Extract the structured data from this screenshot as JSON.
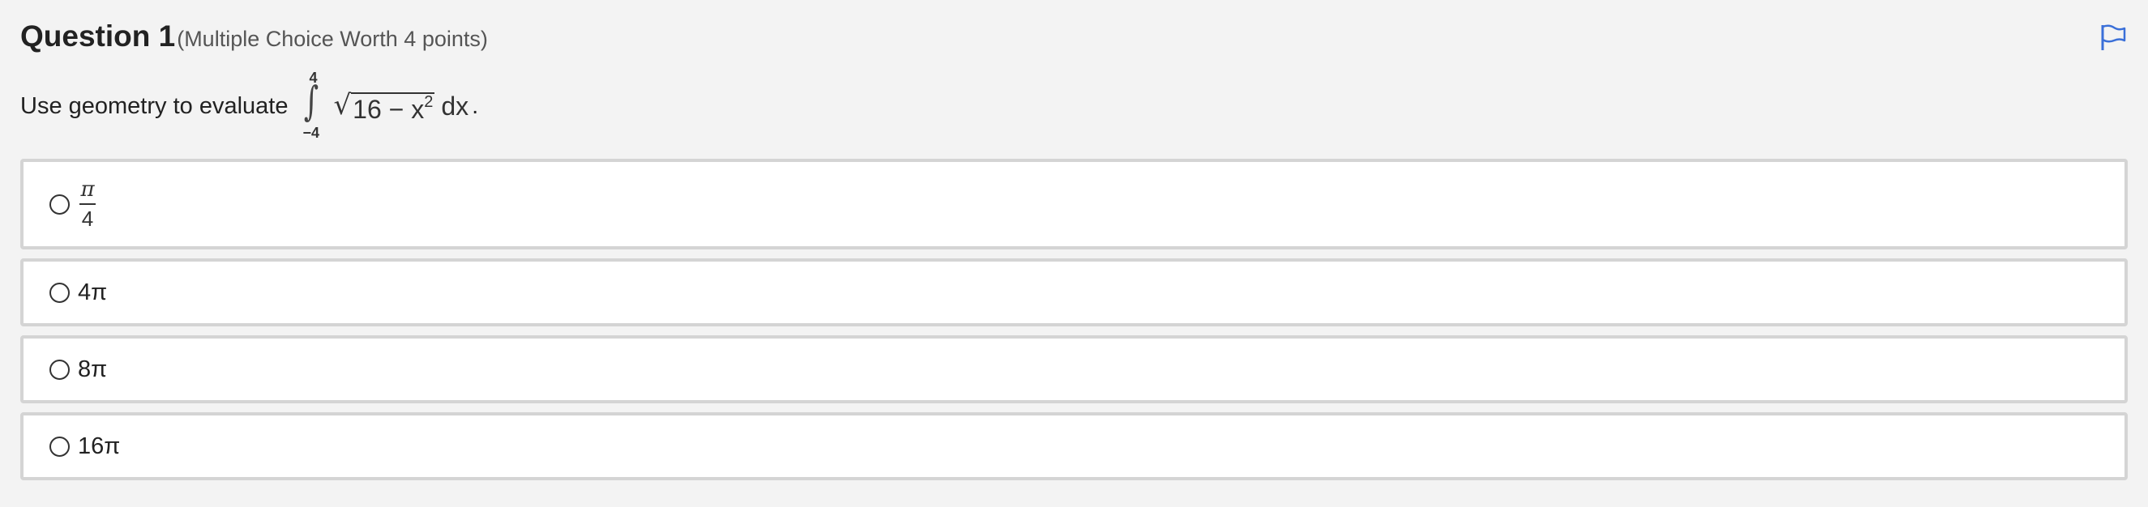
{
  "question": {
    "title": "Question 1",
    "meta": "(Multiple Choice Worth 4 points)"
  },
  "flag_icon": "flag-icon",
  "prompt": {
    "text": "Use geometry to evaluate",
    "integral": {
      "upper": "4",
      "lower": "−4",
      "radicand": "16 − x",
      "exponent": "2",
      "differential": "dx",
      "end": "."
    }
  },
  "options": [
    {
      "numerator": "π",
      "denominator": "4"
    },
    {
      "label": "4π"
    },
    {
      "label": "8π"
    },
    {
      "label": "16π"
    }
  ],
  "colors": {
    "page_bg": "#f3f3f3",
    "card_bg": "#ffffff",
    "card_border": "#d4d4d4",
    "flag": "#3a6fd8"
  }
}
